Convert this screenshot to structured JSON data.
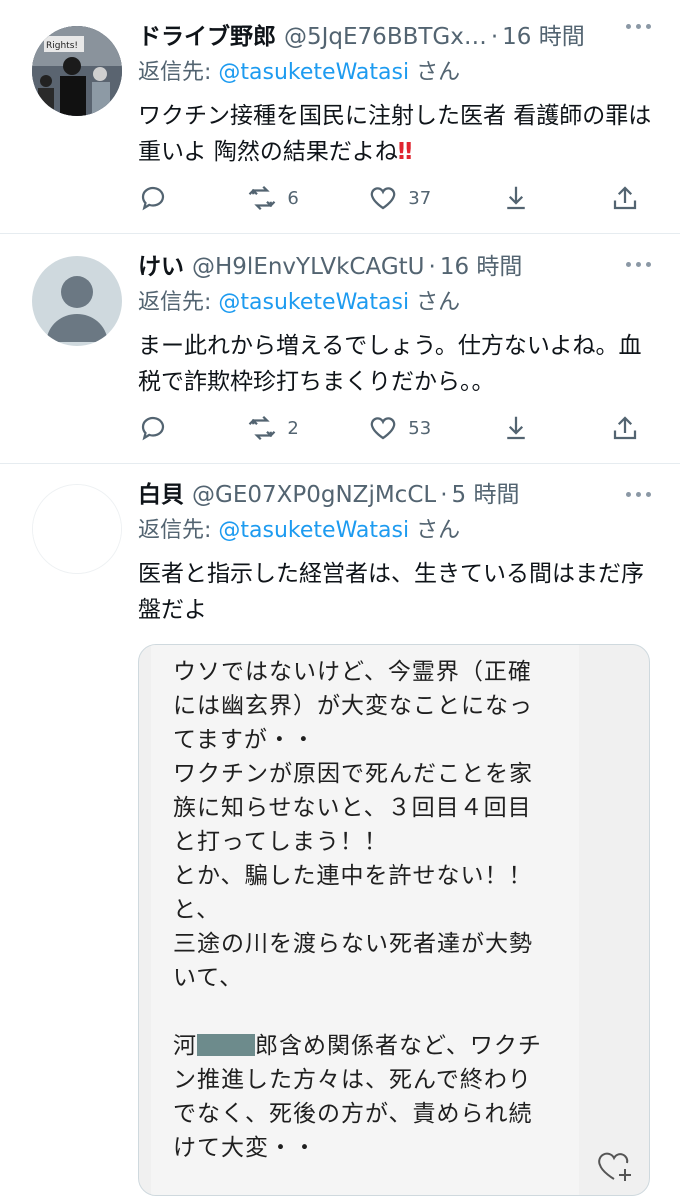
{
  "tweets": [
    {
      "name": "ドライブ野郎",
      "handle": "@5JqE76BBTGx…",
      "time": "16 時間",
      "reply_prefix": "返信先: ",
      "reply_to": "@tasuketeWatasi",
      "reply_suffix": " さん",
      "text": "ワクチン接種を国民に注射した医者 看護師の罪は重いよ 陶然の結果だよね",
      "emoji": "‼",
      "retweets": "6",
      "likes": "37",
      "avatar_text": "Rights!"
    },
    {
      "name": "けい",
      "handle": "@H9lEnvYLVkCAGtU",
      "time": "16 時間",
      "reply_prefix": "返信先: ",
      "reply_to": "@tasuketeWatasi",
      "reply_suffix": " さん",
      "text": "まー此れから増えるでしょう。仕方ないよね。血税で詐欺枠珍打ちまくりだから。。",
      "retweets": "2",
      "likes": "53"
    },
    {
      "name": "白貝",
      "handle": "@GE07XP0gNZjMcCL",
      "time": "5 時間",
      "reply_prefix": "返信先: ",
      "reply_to": "@tasuketeWatasi",
      "reply_suffix": " さん",
      "text": "医者と指示した経営者は、生きている間はまだ序盤だよ",
      "image_lines": [
        "ウソではないけど、今霊界（正確",
        "には幽玄界）が大変なことになっ",
        "てますが・・",
        "ワクチンが原因で死んだことを家",
        "族に知らせないと、３回目４回目",
        "と打ってしまう！！",
        "とか、騙した連中を許せない！！",
        "と、",
        "三途の川を渡らない死者達が大勢",
        "いて、",
        "",
        "河",
        "郎含め関係者など、ワクチ",
        "ン推進した方々は、死んで終わり",
        "でなく、死後の方が、責められ続",
        "けて大変・・"
      ]
    }
  ],
  "colors": {
    "accent": "#1d9bf0",
    "muted": "#536471",
    "divider": "#e6ecf0"
  },
  "icons": [
    "more-icon",
    "reply-icon",
    "retweet-icon",
    "like-icon",
    "share-icon",
    "upload-icon",
    "heart-plus-icon"
  ]
}
